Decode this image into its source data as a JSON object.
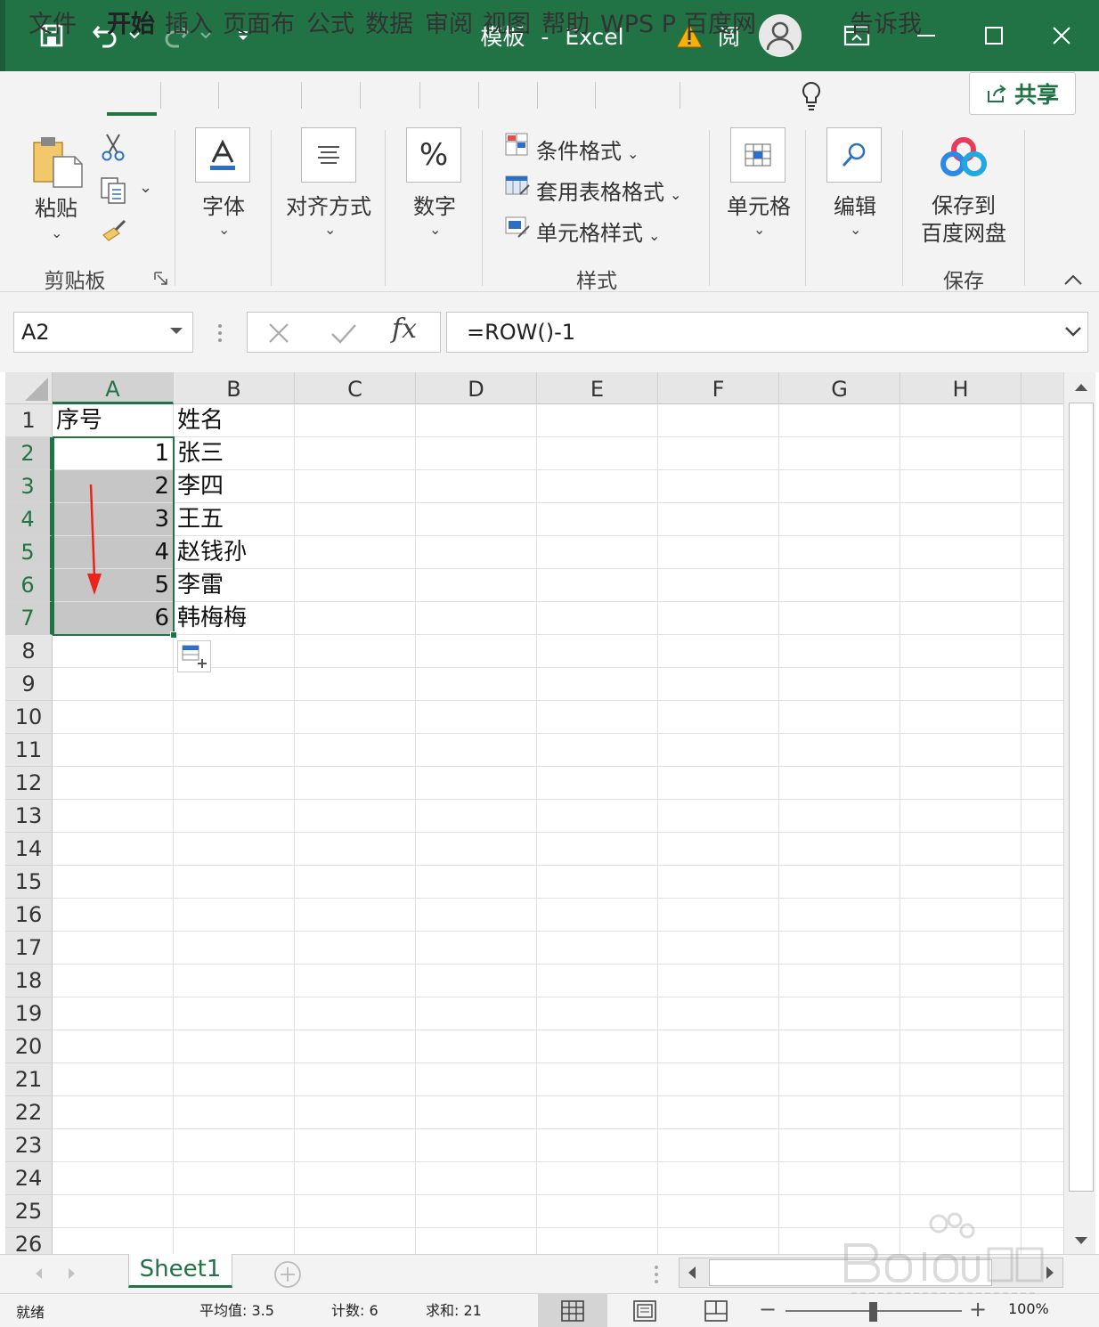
{
  "titlebar": {
    "title": "模板",
    "separator": "-",
    "app": "Excel",
    "reader_label": "阅"
  },
  "tabs": [
    {
      "label": "文件",
      "active": false
    },
    {
      "label": "开始",
      "active": true
    },
    {
      "label": "插入",
      "active": false
    },
    {
      "label": "页面布",
      "active": false
    },
    {
      "label": "公式",
      "active": false
    },
    {
      "label": "数据",
      "active": false
    },
    {
      "label": "审阅",
      "active": false
    },
    {
      "label": "视图",
      "active": false
    },
    {
      "label": "帮助",
      "active": false
    },
    {
      "label": "WPS P",
      "active": false
    },
    {
      "label": "百度网",
      "active": false
    }
  ],
  "tell_me": "告诉我",
  "share_label": "共享",
  "ribbon": {
    "paste_label": "粘贴",
    "clipboard_group": "剪贴板",
    "font_label": "字体",
    "align_label": "对齐方式",
    "number_label": "数字",
    "styles": {
      "conditional": "条件格式",
      "table_format": "套用表格格式",
      "cell_style": "单元格样式",
      "group": "样式"
    },
    "cells_label": "单元格",
    "edit_label": "编辑",
    "save_to": "保存到",
    "save_to_line2": "百度网盘",
    "save_group": "保存"
  },
  "formula_bar": {
    "name_box": "A2",
    "formula": "=ROW()-1"
  },
  "columns": [
    "A",
    "B",
    "C",
    "D",
    "E",
    "F",
    "G",
    "H"
  ],
  "rows": [
    "1",
    "2",
    "3",
    "4",
    "5",
    "6",
    "7",
    "8",
    "9",
    "10",
    "11",
    "12",
    "13",
    "14",
    "15",
    "16",
    "17",
    "18",
    "19",
    "20",
    "21",
    "22",
    "23",
    "24",
    "25",
    "26"
  ],
  "cells": {
    "A1": "序号",
    "B1": "姓名",
    "A2": "1",
    "B2": "张三",
    "A3": "2",
    "B3": "李四",
    "A4": "3",
    "B4": "王五",
    "A5": "4",
    "B5": "赵钱孙",
    "A6": "5",
    "B6": "李雷",
    "A7": "6",
    "B7": "韩梅梅"
  },
  "sheet_tab": "Sheet1",
  "status": {
    "ready": "就绪",
    "average": "平均值: 3.5",
    "count": "计数: 6",
    "sum": "求和: 21",
    "zoom": "100%"
  },
  "colors": {
    "brand": "#217346",
    "selection_fill": "#c6c6c6",
    "arrow": "#e8241c"
  }
}
